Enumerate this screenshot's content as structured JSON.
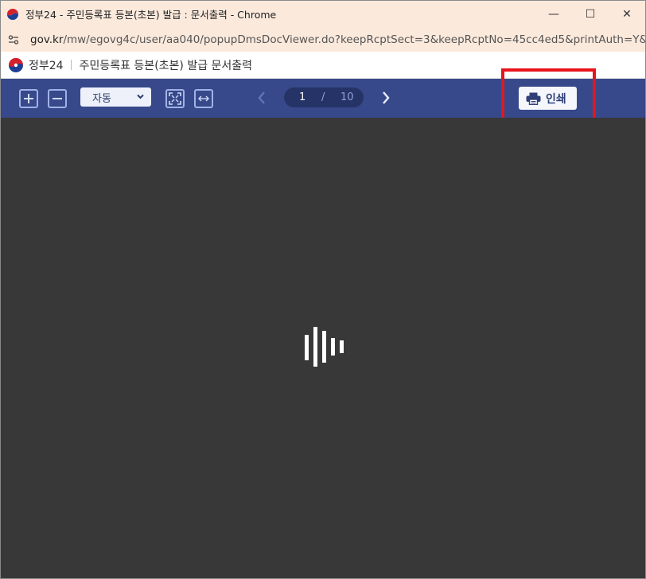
{
  "window": {
    "title": "정부24 - 주민등록표 등본(초본) 발급 : 문서출력 - Chrome",
    "minimize_glyph": "—",
    "maximize_glyph": "☐",
    "close_glyph": "✕"
  },
  "address_bar": {
    "host": "gov.kr",
    "path": "/mw/egovg4c/user/aa040/popupDmsDocViewer.do?keepRcptSect=3&keepRcptNo=45cc4ed5&printAuth=Y&..."
  },
  "page_header": {
    "brand": "정부24",
    "title": "주민등록표 등본(초본) 발급 문서출력"
  },
  "toolbar": {
    "zoom_value": "자동",
    "current_page": "1",
    "page_separator": "/",
    "total_pages": "10",
    "print_label": "인쇄"
  },
  "colors": {
    "titlebar_bg": "#fbe9dc",
    "toolbar_bg": "#37498a",
    "viewer_bg": "#383838",
    "highlight": "#e8141b"
  },
  "icons": [
    "chrome-site-icon",
    "site-settings-icon",
    "gov-logo-icon",
    "zoom-in-icon",
    "zoom-out-icon",
    "chevron-down-icon",
    "fit-page-icon",
    "fit-width-icon",
    "prev-page-icon",
    "next-page-icon",
    "printer-icon",
    "loading-spinner-icon"
  ]
}
